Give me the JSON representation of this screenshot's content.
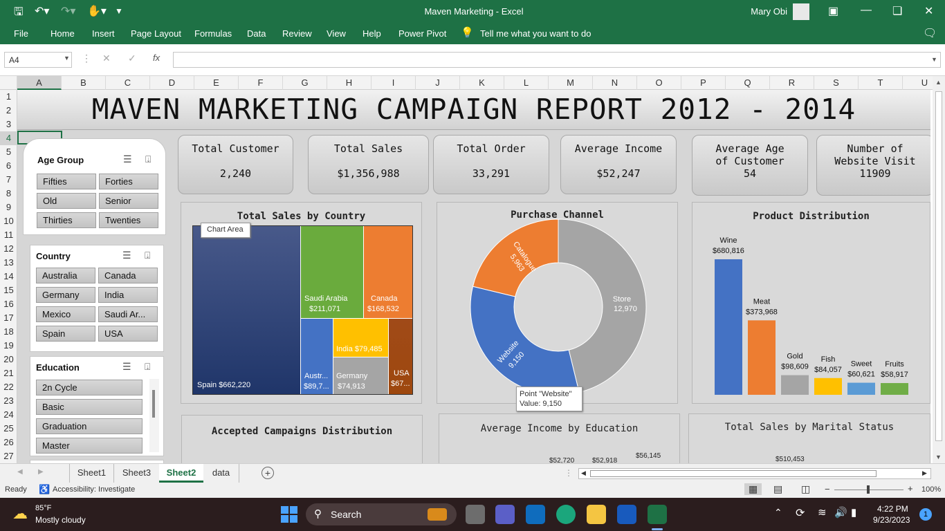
{
  "window": {
    "title": "Maven Marketing  -  Excel",
    "user": "Mary Obi"
  },
  "ribbon_tabs": [
    "File",
    "Home",
    "Insert",
    "Page Layout",
    "Formulas",
    "Data",
    "Review",
    "View",
    "Help",
    "Power Pivot"
  ],
  "tell_me": "Tell me what you want to do",
  "formula_bar": {
    "name_box": "A4",
    "fx": "fx",
    "value": ""
  },
  "columns": [
    "A",
    "B",
    "C",
    "D",
    "E",
    "F",
    "G",
    "H",
    "I",
    "J",
    "K",
    "L",
    "M",
    "N",
    "O",
    "P",
    "Q",
    "R",
    "S",
    "T",
    "U"
  ],
  "rows": [
    "1",
    "2",
    "3",
    "4",
    "5",
    "6",
    "7",
    "8",
    "9",
    "10",
    "11",
    "12",
    "13",
    "14",
    "15",
    "16",
    "17",
    "18",
    "19",
    "20",
    "21",
    "22",
    "23",
    "24",
    "25",
    "26",
    "27"
  ],
  "dashboard": {
    "title": "MAVEN MARKETING CAMPAIGN REPORT 2012 - 2014",
    "kpis": [
      {
        "label": "Total Customer",
        "value": "2,240"
      },
      {
        "label": "Total Sales",
        "value": "$1,356,988"
      },
      {
        "label": "Total Order",
        "value": "33,291"
      },
      {
        "label": "Average Income",
        "value": "$52,247"
      },
      {
        "label": "Average Age of Customer",
        "value": "54"
      },
      {
        "label": "Number of Website Visit",
        "value": "11909"
      }
    ],
    "slicers": {
      "age_group": {
        "title": "Age Group",
        "items": [
          "Fifties",
          "Forties",
          "Old",
          "Senior",
          "Thirties",
          "Twenties"
        ]
      },
      "country": {
        "title": "Country",
        "items": [
          "Australia",
          "Canada",
          "Germany",
          "India",
          "Mexico",
          "Saudi Ar...",
          "Spain",
          "USA"
        ]
      },
      "education": {
        "title": "Education",
        "items": [
          "2n Cycle",
          "Basic",
          "Graduation",
          "Master"
        ]
      }
    },
    "chart_titles": {
      "sales_by_country": "Total Sales by Country",
      "purchase_channel": "Purchase Channel",
      "product_distribution": "Product Distribution",
      "accepted_campaigns": "Accepted Campaigns Distribution",
      "income_by_education": "Average Income by Education",
      "sales_by_marital": "Total Sales by Marital Status"
    },
    "tooltips": {
      "chart_area": "Chart Area",
      "point_name": "Point \"Website\"",
      "point_value": "Value:  9,150"
    },
    "partial_labels": {
      "edu1": "$52,720",
      "edu2": "$52,918",
      "edu3": "$56,145",
      "marital1": "$510,453"
    }
  },
  "chart_data": [
    {
      "type": "treemap",
      "title": "Total Sales by Country",
      "labels": [
        "Spain  $662,220",
        "Saudi Arabia",
        "$211,071",
        "Canada",
        "$168,532",
        "India  $79,485",
        "Austr...",
        "$89,7...",
        "Germany",
        "$74,913",
        "USA",
        "$67..."
      ],
      "categories": [
        "Spain",
        "Saudi Arabia",
        "Canada",
        "India",
        "Australia",
        "Germany",
        "USA"
      ],
      "values": [
        662220,
        211071,
        168532,
        79485,
        89700,
        74913,
        67000
      ],
      "colors": [
        "#2c4b8c",
        "#6aab3d",
        "#ed7d31",
        "#ffc000",
        "#4472c4",
        "#a5a5a5",
        "#9e480e"
      ]
    },
    {
      "type": "pie",
      "title": "Purchase Channel",
      "categories": [
        "Store",
        "Website",
        "Catalogue"
      ],
      "values": [
        12970,
        9150,
        5963
      ],
      "value_labels": [
        "12,970",
        "9,150",
        "5,963"
      ],
      "colors": [
        "#a5a5a5",
        "#4472c4",
        "#ed7d31"
      ]
    },
    {
      "type": "bar",
      "title": "Product Distribution",
      "categories": [
        "Wine",
        "Meat",
        "Gold",
        "Fish",
        "Sweet",
        "Fruits"
      ],
      "values": [
        680816,
        373968,
        98609,
        84057,
        60621,
        58917
      ],
      "value_labels": [
        "$680,816",
        "$373,968",
        "$98,609",
        "$84,057",
        "$60,621",
        "$58,917"
      ],
      "colors": [
        "#4472c4",
        "#ed7d31",
        "#a5a5a5",
        "#ffc000",
        "#5b9bd5",
        "#70ad47"
      ]
    }
  ],
  "sheet_tabs": [
    "Sheet1",
    "Sheet3",
    "Sheet2",
    "data"
  ],
  "active_tab": "Sheet2",
  "status": {
    "ready": "Ready",
    "accessibility": "Accessibility: Investigate",
    "zoom": "100%"
  },
  "taskbar": {
    "temp": "85°F",
    "weather": "Mostly cloudy",
    "search": "Search",
    "time": "4:22 PM",
    "date": "9/23/2023",
    "badge": "1"
  }
}
